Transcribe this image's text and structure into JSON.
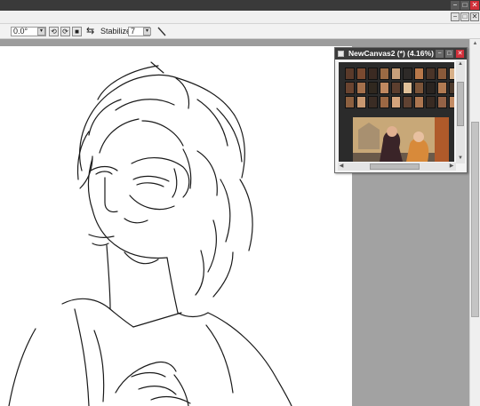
{
  "window": {
    "title_bar_color": "#3a3a3a",
    "controls": {
      "minimize": "−",
      "maximize": "□",
      "close": "✕"
    },
    "doc_controls": {
      "minimize": "−",
      "maximize": "□",
      "close": "✕"
    }
  },
  "toolbar": {
    "angle_value": "0.0°",
    "rotate_left_icon": "⟲",
    "rotate_right_icon": "⟳",
    "reset_icon": "■",
    "flip_icon": "⇆",
    "stabilizer_label": "Stabilizer",
    "stabilizer_value": "7",
    "dropdown_arrow": "▾"
  },
  "navigator": {
    "title": "NewCanvas2 (*) (4.16%)",
    "controls": {
      "minimize": "−",
      "maximize": "□",
      "close": "✕"
    },
    "thumb_colors": [
      "#5a3a2a",
      "#7a4a30",
      "#3b2a22",
      "#9a6a44",
      "#c9a07a",
      "#2e2a28",
      "#b8784a",
      "#4a3428",
      "#8a5a3a",
      "#d8b088",
      "#6a4430",
      "#a4704c",
      "#30281f",
      "#c08860",
      "#5c3e2e",
      "#e0c098",
      "#7c5438",
      "#2a2420",
      "#b07a52",
      "#4e3a2c",
      "#8c6040",
      "#c89870",
      "#3a2c24",
      "#9c6844",
      "#d4a47c",
      "#604232",
      "#ac7650",
      "#382a22",
      "#946246",
      "#c48c64"
    ],
    "scene_colors": {
      "sky": "#c8a878",
      "left_figure": "#3a2428",
      "right_figure": "#d88a3a",
      "ground": "#6a5a4a"
    }
  },
  "scrollbar": {
    "up_arrow": "▲",
    "down_arrow": "▼",
    "left_arrow": "◀",
    "right_arrow": "▶"
  },
  "colors": {
    "workspace": "#a2a2a2",
    "canvas": "#ffffff",
    "close_red": "#d0303a"
  }
}
